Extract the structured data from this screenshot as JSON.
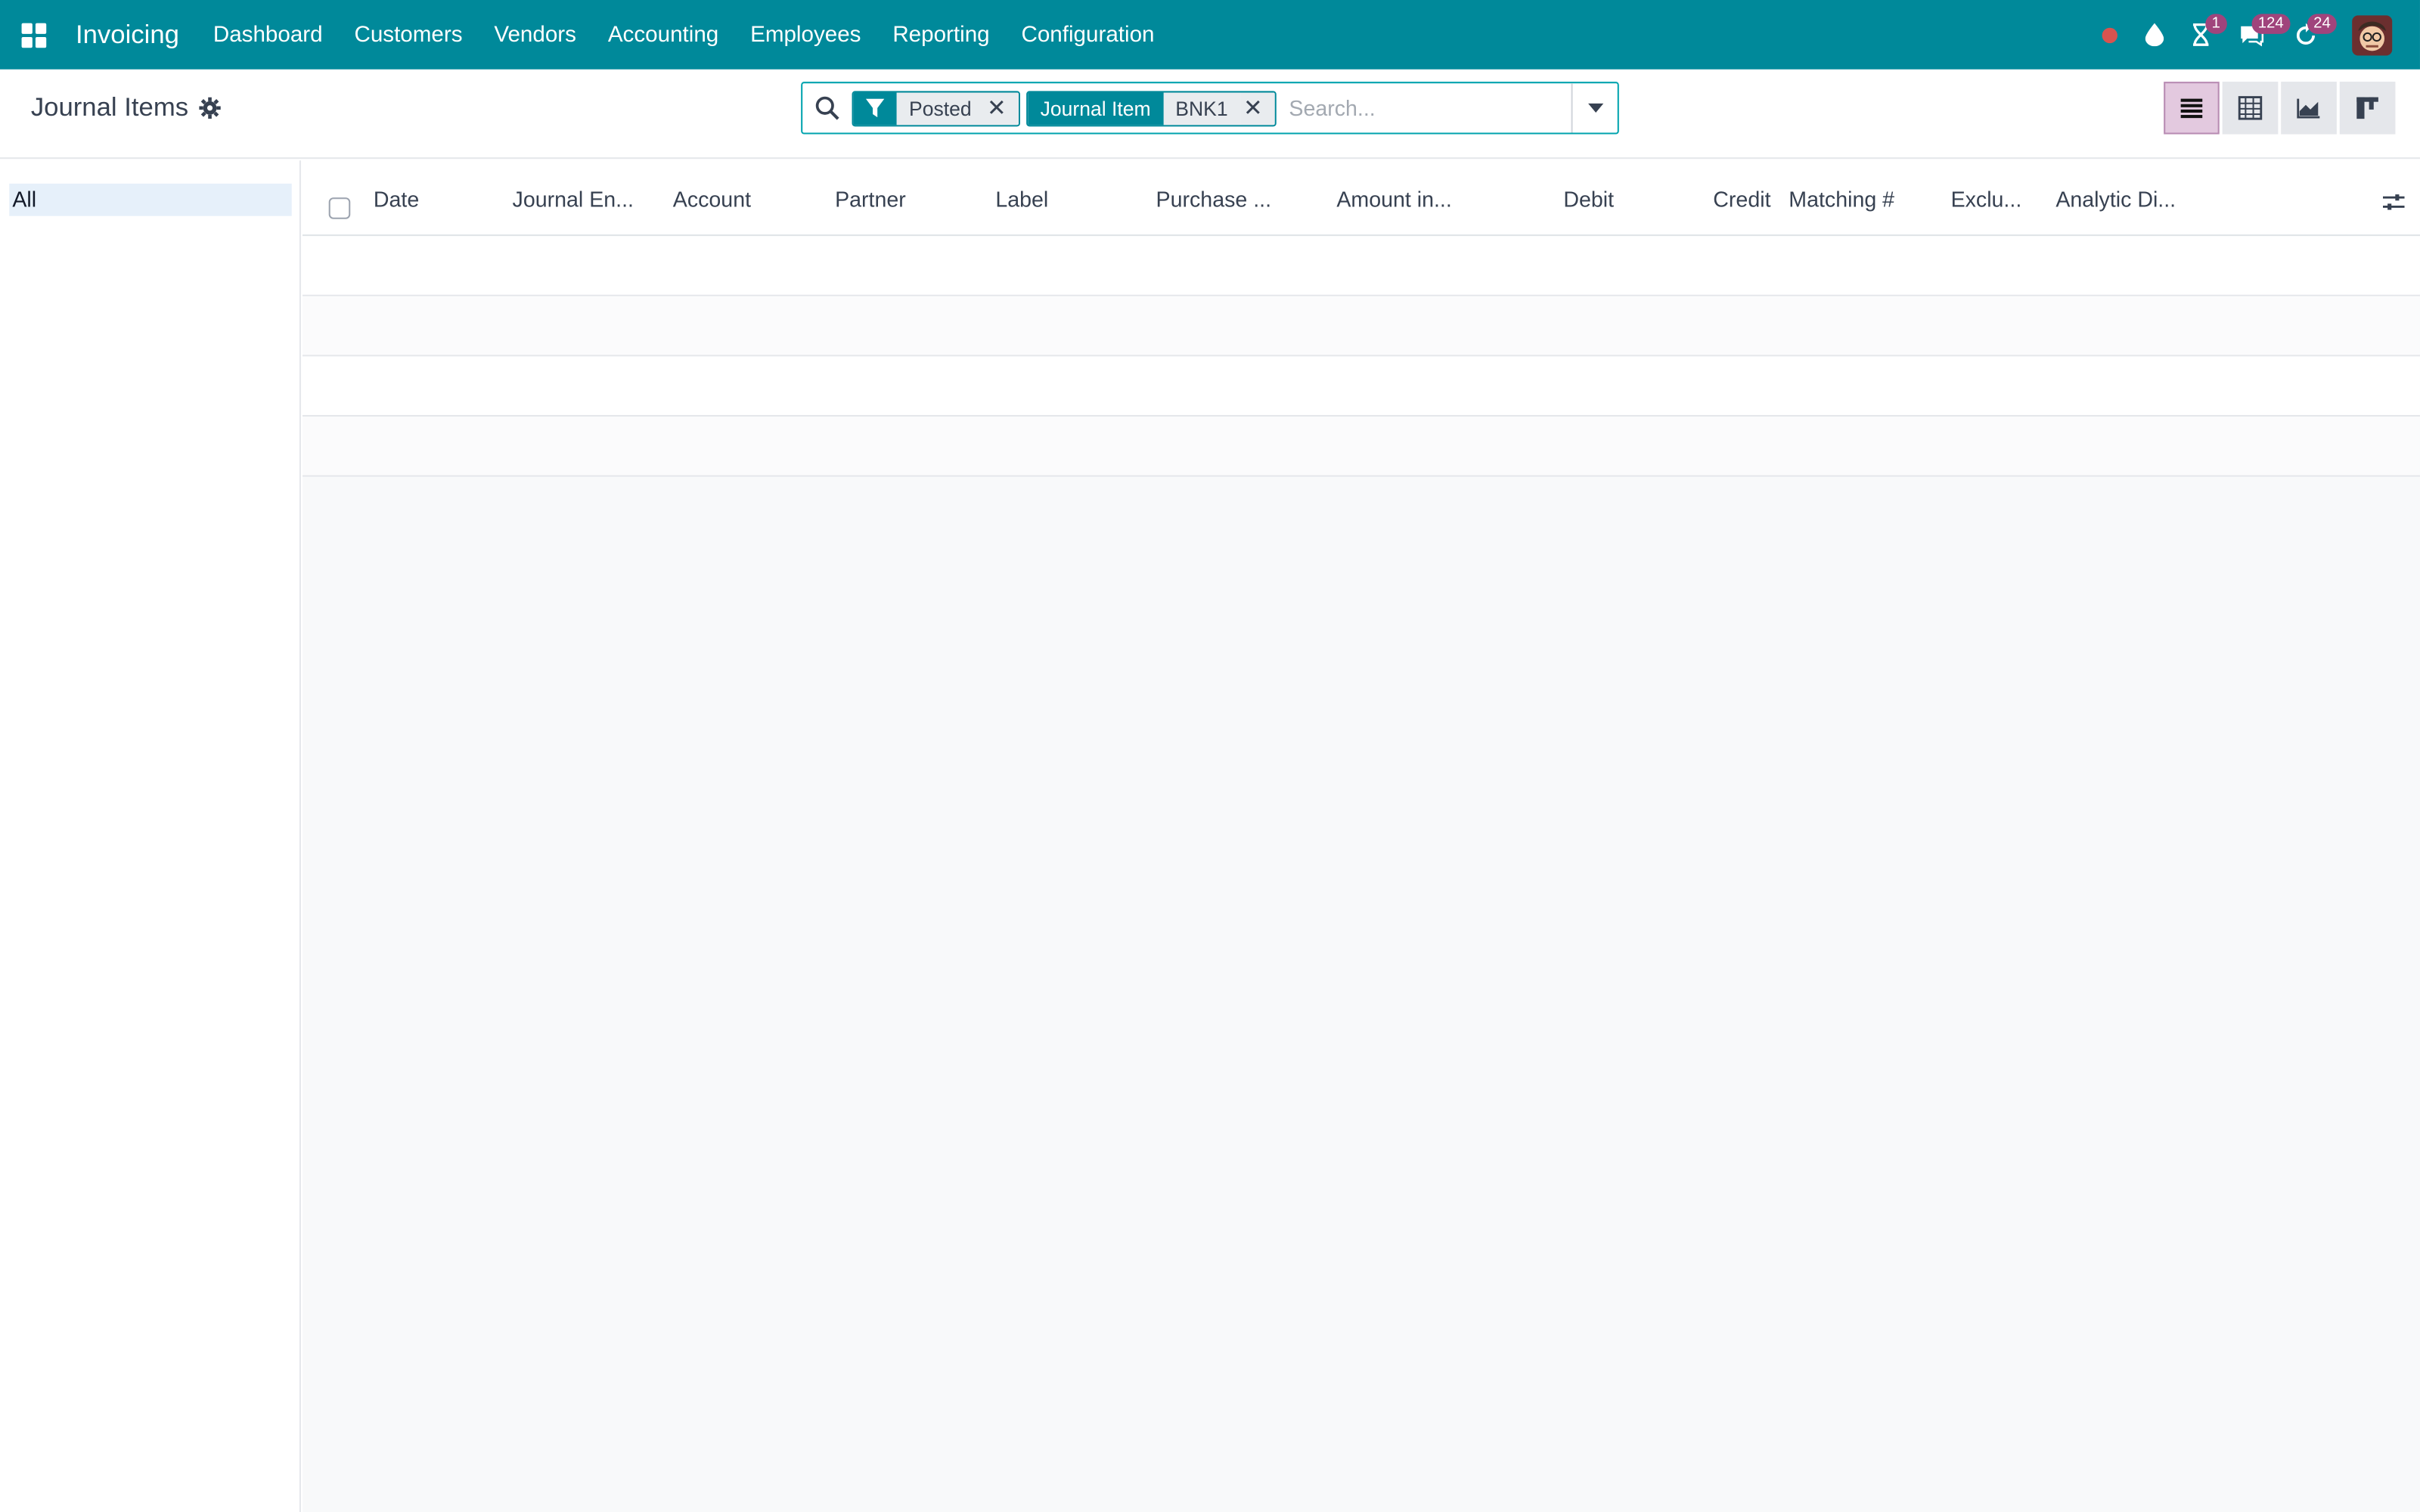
{
  "app": {
    "brand": "Invoicing",
    "menu": [
      "Dashboard",
      "Customers",
      "Vendors",
      "Accounting",
      "Employees",
      "Reporting",
      "Configuration"
    ]
  },
  "systray": {
    "activity_badge": "1",
    "messages_badge": "124",
    "updates_badge": "24"
  },
  "page": {
    "title": "Journal Items"
  },
  "search": {
    "facets": [
      {
        "type": "filter-icon",
        "value": "Posted"
      },
      {
        "type": "Journal Item",
        "value": "BNK1"
      }
    ],
    "placeholder": "Search..."
  },
  "views": [
    "list-view-icon",
    "pivot-view-icon",
    "graph-view-icon",
    "kanban-view-icon"
  ],
  "side_panel": {
    "items": [
      "All"
    ]
  },
  "list": {
    "columns": [
      "Date",
      "Journal En...",
      "Account",
      "Partner",
      "Label",
      "Purchase ...",
      "Amount in...",
      "Debit",
      "Credit",
      "Matching #",
      "Exclu...",
      "Analytic Di..."
    ],
    "rows": []
  },
  "colors": {
    "navbar": "#00899a",
    "accent": "#00a3ae",
    "badge": "#a0447c"
  }
}
